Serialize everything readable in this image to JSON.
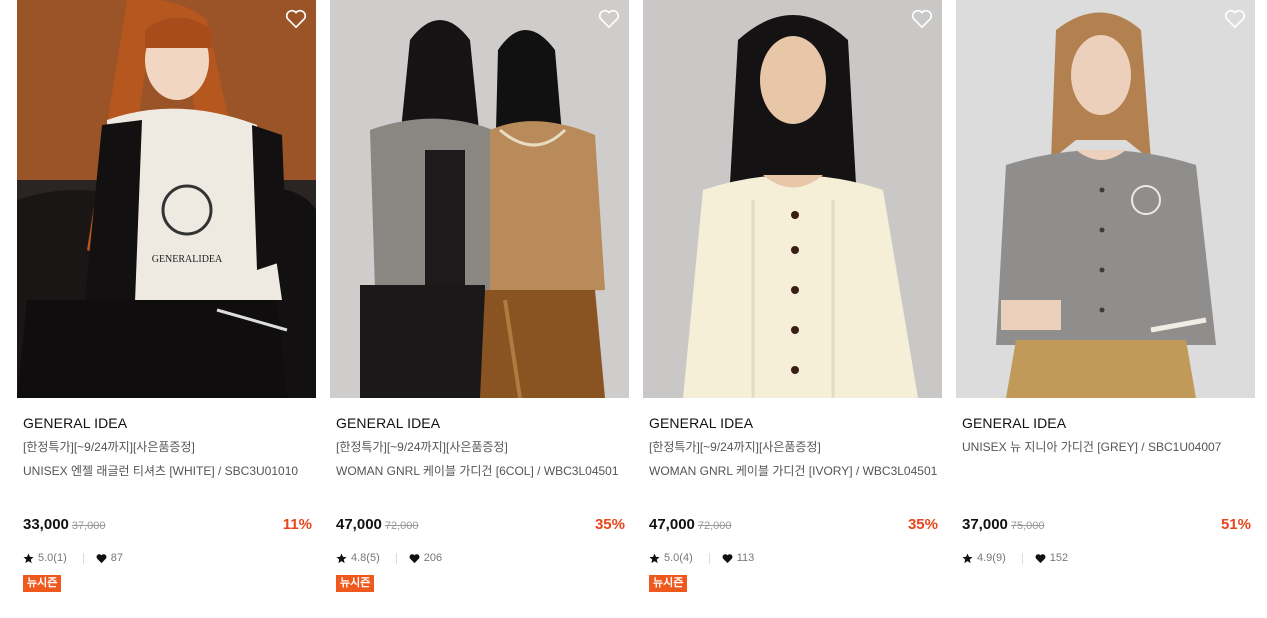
{
  "products": [
    {
      "brand": "GENERAL IDEA",
      "promo": "[한정특가][~9/24까지][사은품증정]",
      "name": "UNISEX 엔젤 래글런 티셔츠 [WHITE] / SBC3U01010",
      "price": "33,000",
      "original_price": "37,000",
      "discount": "11%",
      "rating": "5.0(1)",
      "likes": "87",
      "badge": "뉴시즌"
    },
    {
      "brand": "GENERAL IDEA",
      "promo": "[한정특가][~9/24까지][사은품증정]",
      "name": "WOMAN GNRL 케이블 가디건 [6COL] / WBC3L04501",
      "price": "47,000",
      "original_price": "72,000",
      "discount": "35%",
      "rating": "4.8(5)",
      "likes": "206",
      "badge": "뉴시즌"
    },
    {
      "brand": "GENERAL IDEA",
      "promo": "[한정특가][~9/24까지][사은품증정]",
      "name": "WOMAN GNRL 케이블 가디건 [IVORY] / WBC3L04501",
      "price": "47,000",
      "original_price": "72,000",
      "discount": "35%",
      "rating": "5.0(4)",
      "likes": "113",
      "badge": "뉴시즌"
    },
    {
      "brand": "GENERAL IDEA",
      "promo": "",
      "name": "UNISEX 뉴 지니아 가디건 [GREY] / SBC1U04007",
      "price": "37,000",
      "original_price": "75,000",
      "discount": "51%",
      "rating": "4.9(9)",
      "likes": "152",
      "badge": ""
    }
  ],
  "colors": {
    "discount": "#e8461a",
    "badge_bg": "#f0591d"
  },
  "icons": {
    "wishlist": "heart-outline-icon",
    "rating": "star-icon",
    "likes": "heart-filled-icon"
  }
}
